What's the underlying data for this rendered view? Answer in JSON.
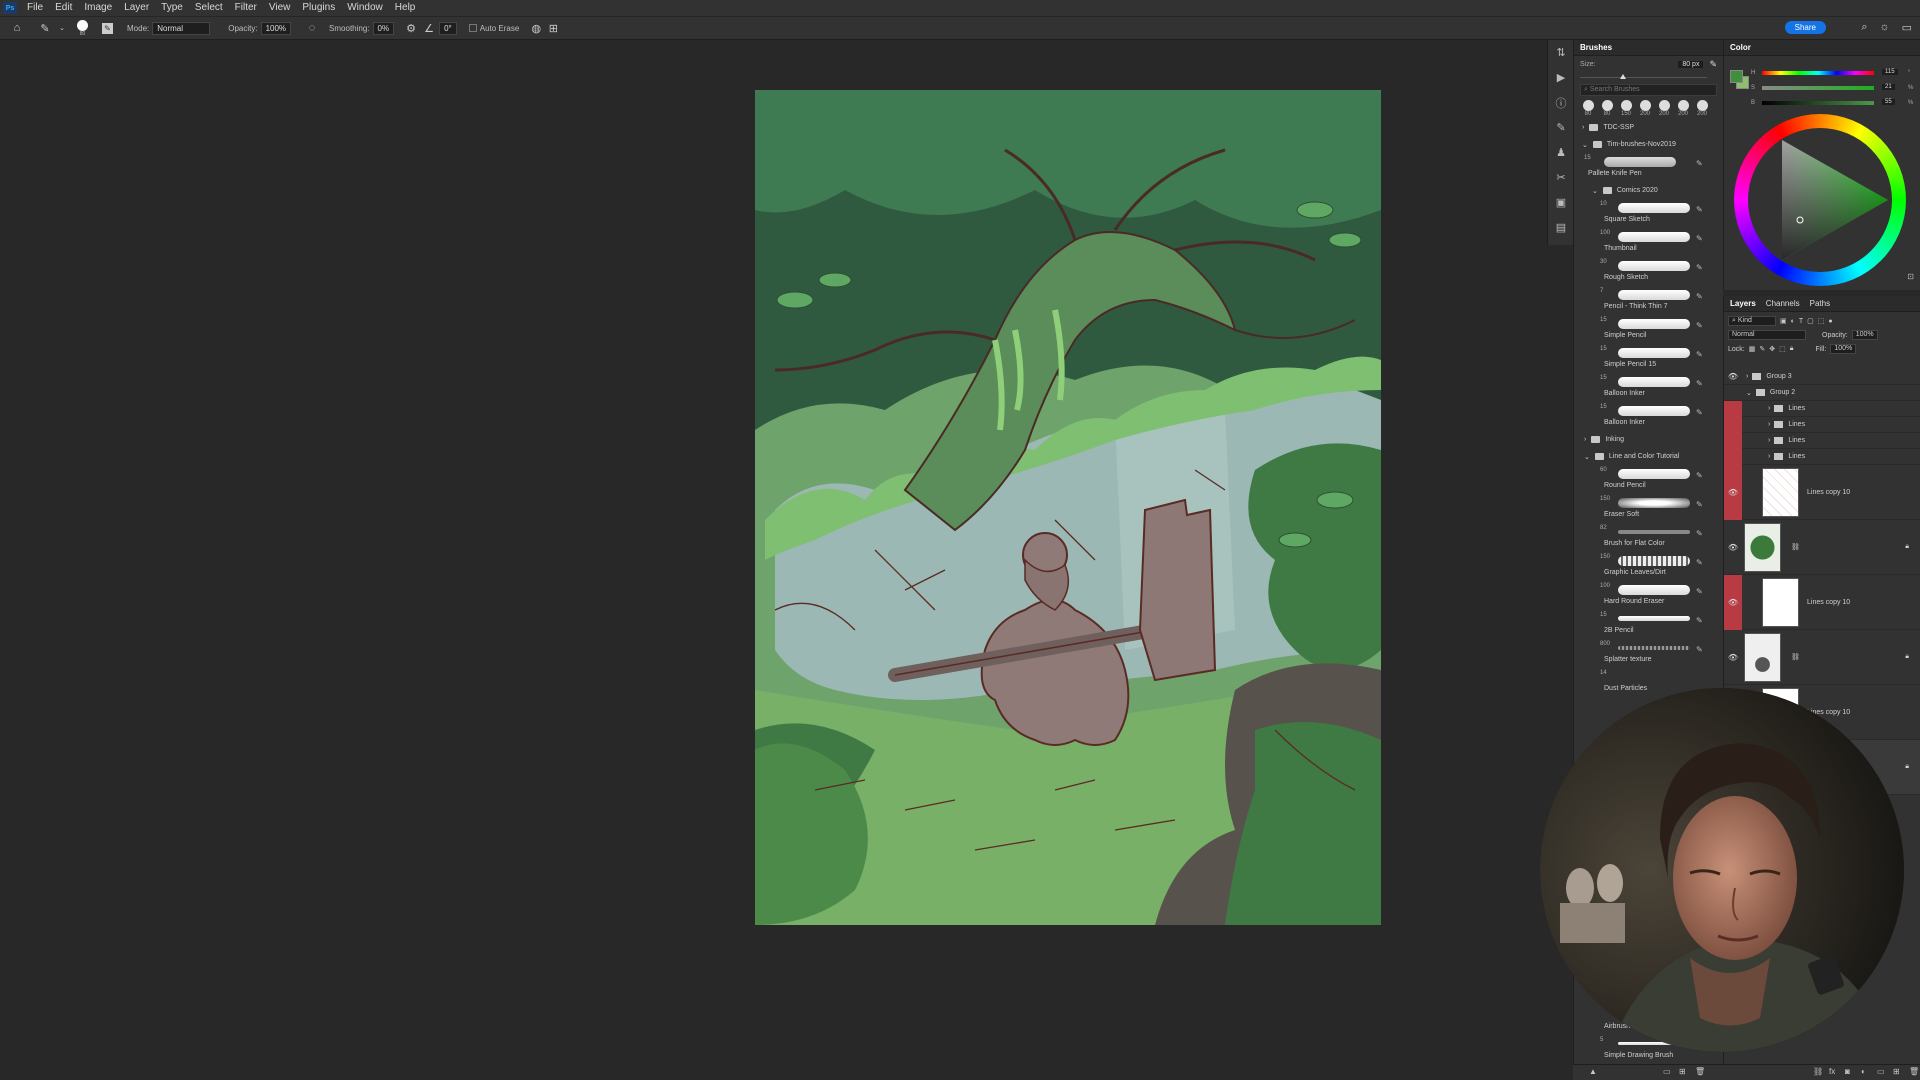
{
  "app": {
    "logo_text": "Ps"
  },
  "menu": [
    "File",
    "Edit",
    "Image",
    "Layer",
    "Type",
    "Select",
    "Filter",
    "View",
    "Plugins",
    "Window",
    "Help"
  ],
  "options": {
    "mode_label": "Mode:",
    "mode_value": "Normal",
    "opacity_label": "Opacity:",
    "opacity_value": "100%",
    "smoothing_label": "Smoothing:",
    "smoothing_value": "0%",
    "angle_value": "0°",
    "auto_erase": "Auto Erase",
    "brush_size": "80"
  },
  "share_label": "Share",
  "brushes_panel": {
    "tab": "Brushes",
    "size_label": "Size:",
    "size_value": "80 px",
    "search_placeholder": "Search Brushes",
    "preset_sizes": [
      "80",
      "80",
      "150",
      "200",
      "200",
      "200",
      "200"
    ],
    "folders": {
      "tdc": "TDC-SSP",
      "tim": "Tim-brushes-Nov2019",
      "comics": "Comics 2020",
      "inking": "Inking",
      "line_color": "Line and Color Tutorial"
    },
    "palette_knife": {
      "num": "15",
      "name": "Pallete Knife Pen"
    },
    "comics_brushes": [
      {
        "num": "10",
        "name": "Square Sketch"
      },
      {
        "num": "100",
        "name": "Thumbnail"
      },
      {
        "num": "30",
        "name": "Rough Sketch"
      },
      {
        "num": "7",
        "name": "Pencil - Think Thin 7"
      },
      {
        "num": "15",
        "name": "Simple Pencil"
      },
      {
        "num": "15",
        "name": "Simple Pencil 15"
      },
      {
        "num": "15",
        "name": "Balloon Inker"
      },
      {
        "num": "15",
        "name": "Balloon Inker"
      }
    ],
    "tutorial_brushes": [
      {
        "num": "60",
        "name": "Round Pencil"
      },
      {
        "num": "150",
        "name": "Eraser Soft"
      },
      {
        "num": "82",
        "name": "Brush for Flat Color"
      },
      {
        "num": "150",
        "name": "Graphic Leaves/Dirt"
      },
      {
        "num": "100",
        "name": "Hard Round Eraser"
      },
      {
        "num": "15",
        "name": "2B Pencil"
      },
      {
        "num": "800",
        "name": "Splatter texture"
      },
      {
        "num": "14",
        "name": "Dust Particles"
      }
    ],
    "bottom_brushes": [
      {
        "num": "",
        "name": "Airbrush"
      },
      {
        "num": "5",
        "name": "Simple Drawing Brush"
      }
    ]
  },
  "color_panel": {
    "tab": "Color",
    "fg_color": "#3f8f3c",
    "bg_color": "#8fbf6b",
    "h_label": "H",
    "s_label": "S",
    "b_label": "B",
    "h_value": "115",
    "s_value": "21",
    "b_value": "55",
    "unit_deg": "°",
    "unit_pct": "%"
  },
  "layers_panel": {
    "tabs": [
      "Layers",
      "Channels",
      "Paths"
    ],
    "kind_label": "Kind",
    "blend_mode": "Normal",
    "opacity_label": "Opacity:",
    "opacity_value": "100%",
    "lock_label": "Lock:",
    "fill_label": "Fill:",
    "fill_value": "100%",
    "groups": [
      "Group 3",
      "Group 2"
    ],
    "lines_rows": [
      "Lines",
      "Lines",
      "Lines",
      "Lines"
    ],
    "layers": [
      {
        "name": "Lines copy 10",
        "red": true
      },
      {
        "name": "",
        "red": false
      },
      {
        "name": "Lines copy 10",
        "red": true
      },
      {
        "name": "",
        "red": false
      },
      {
        "name": "Lines copy 10",
        "red": false
      }
    ]
  },
  "colors": {
    "accent": "#1473e6",
    "red_eye": "#b83b44",
    "canvas_green": "#6fa36c"
  }
}
